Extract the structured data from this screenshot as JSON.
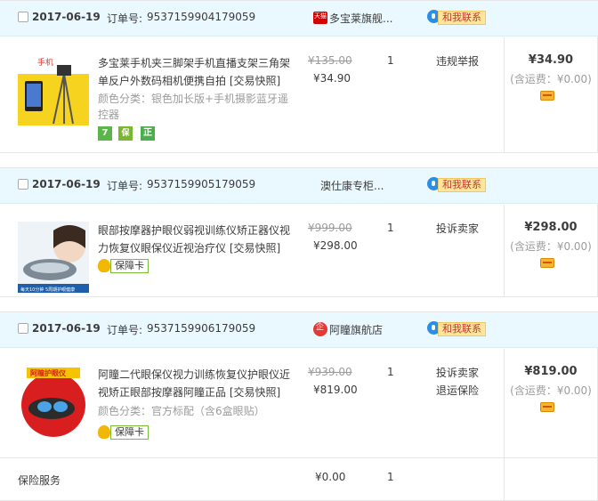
{
  "orders": [
    {
      "date": "2017-06-19",
      "order_no_label": "订单号:",
      "order_no": "9537159904179059",
      "shop": "多宝莱旗舰...",
      "contact": "和我联系",
      "item": {
        "thumb_caption": "手机",
        "title": "多宝莱手机夹三脚架手机直播支架三角架单反户外数码相机便携自拍 [交易快照]",
        "sku": "颜色分类：银色加长版+手机摄影蓝牙遥控器",
        "orig_price": "¥135.00",
        "price": "¥34.90",
        "qty": "1",
        "actions": [
          "违规举报"
        ],
        "badges": [
          "7",
          "保",
          "正"
        ]
      },
      "total": "¥34.90",
      "shipping": "(含运费：¥0.00)"
    },
    {
      "date": "2017-06-19",
      "order_no_label": "订单号:",
      "order_no": "9537159905179059",
      "shop": "澳仕康专柜...",
      "contact": "和我联系",
      "item": {
        "thumb_caption": "每天10分钟 5周期护眼健康",
        "title": "眼部按摩器护眼仪弱视训练仪矫正器仪视力恢复仪眼保仪近视治疗仪 [交易快照]",
        "sku": "",
        "orig_price": "¥999.00",
        "price": "¥298.00",
        "qty": "1",
        "actions": [
          "投诉卖家"
        ],
        "guard": "保障卡"
      },
      "total": "¥298.00",
      "shipping": "(含运费：¥0.00)"
    },
    {
      "date": "2017-06-19",
      "order_no_label": "订单号:",
      "order_no": "9537159906179059",
      "shop": "阿瞳旗航店",
      "contact": "和我联系",
      "item": {
        "thumb_caption": "阿瞳护眼仪",
        "title": "阿瞳二代眼保仪视力训练恢复仪护眼仪近视矫正眼部按摩器阿瞳正品 [交易快照]",
        "sku": "颜色分类：官方标配（含6盒眼贴）",
        "orig_price": "¥939.00",
        "price": "¥819.00",
        "qty": "1",
        "actions": [
          "投诉卖家",
          "退运保险"
        ],
        "guard": "保障卡"
      },
      "total": "¥819.00",
      "shipping": "(含运费：¥0.00)",
      "insurance": {
        "label": "保险服务",
        "price": "¥0.00",
        "qty": "1"
      }
    }
  ],
  "colors": {
    "header_bg": "#eaf8ff",
    "contact_bg": "#ffe69b",
    "contact_text": "#cc3333",
    "muted": "#9c9c9c"
  }
}
